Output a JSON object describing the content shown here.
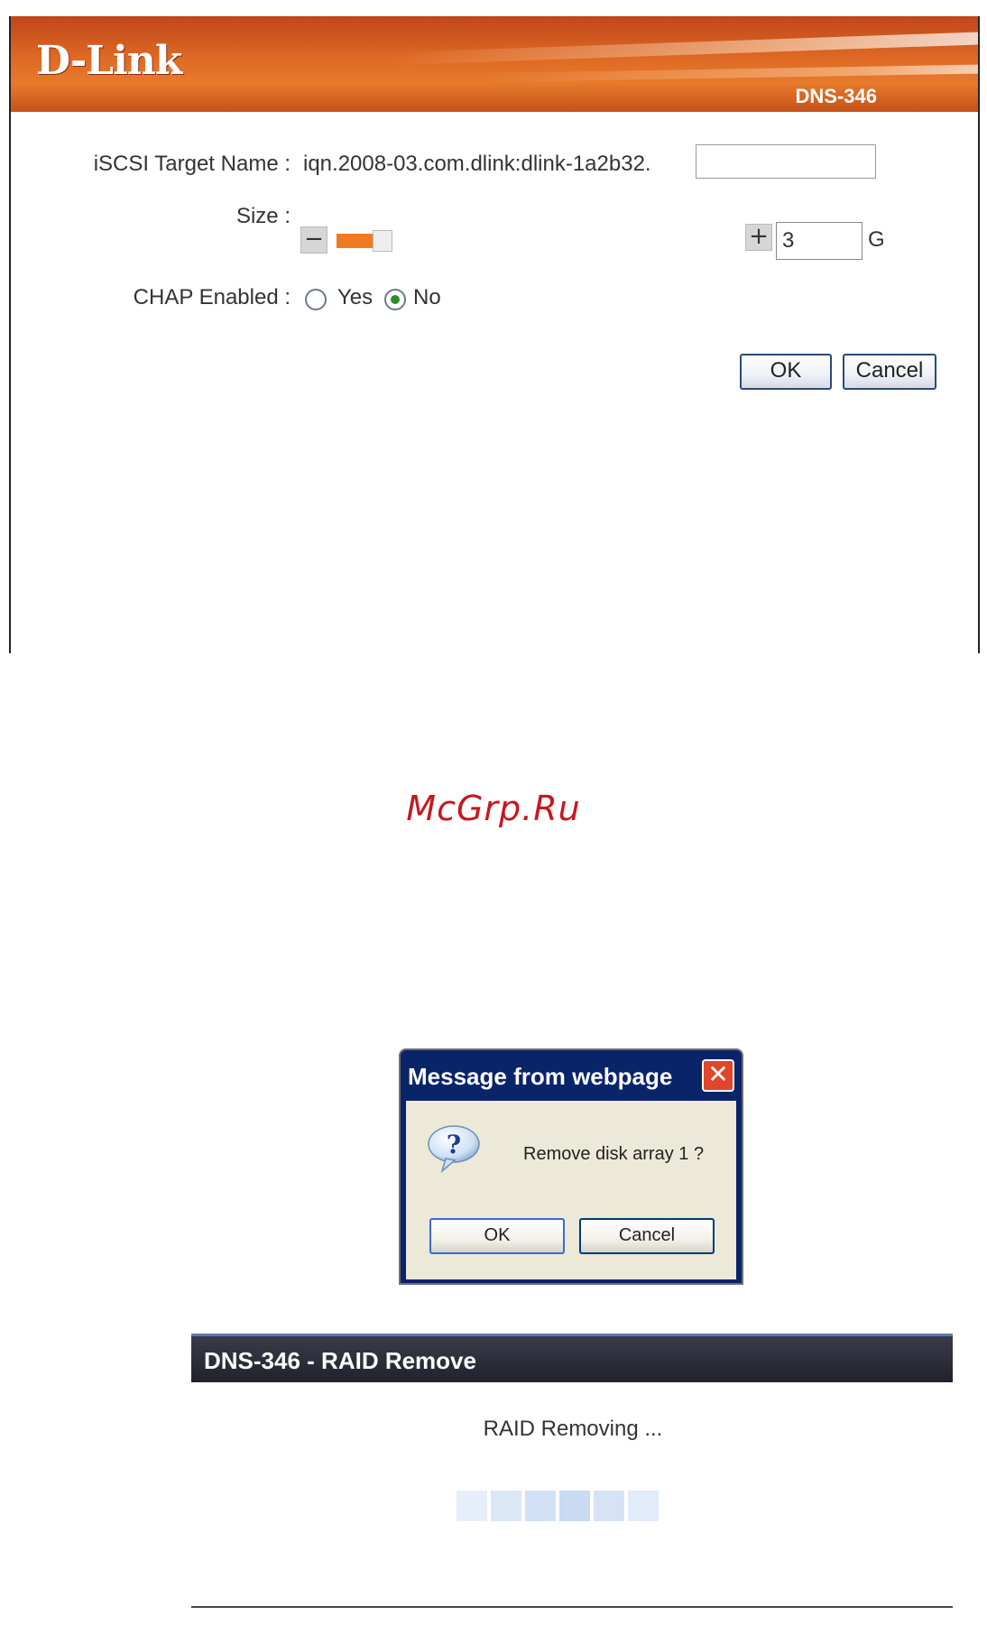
{
  "header": {
    "brand": "D-Link",
    "model": "DNS-346"
  },
  "iscsi_form": {
    "target_name_label": "iSCSI Target Name :",
    "target_name_prefix": "iqn.2008-03.com.dlink:dlink-1a2b32.",
    "target_name_value": "",
    "size_label": "Size :",
    "size_minus": "−",
    "size_plus": "+",
    "size_value": "3",
    "size_unit": "G",
    "size_slider_fraction": 0.6,
    "chap_label": "CHAP Enabled :",
    "chap_options": [
      "Yes",
      "No"
    ],
    "chap_selected": "No",
    "ok_label": "OK",
    "cancel_label": "Cancel",
    "accent_color": "#f07a22"
  },
  "watermark": "McGrp.Ru",
  "dialog": {
    "title": "Message from webpage",
    "close_glyph": "✕",
    "message": "Remove disk array 1 ?",
    "ok_label": "OK",
    "cancel_label": "Cancel"
  },
  "raid_remove": {
    "title": "DNS-346 - RAID Remove",
    "status": "RAID Removing ...",
    "progress_blocks": 6,
    "progress_colors": [
      "#e6eefa",
      "#dbe6f7",
      "#d2e0f5",
      "#c9daf3",
      "#d6e3f6",
      "#e2ebf9"
    ]
  }
}
